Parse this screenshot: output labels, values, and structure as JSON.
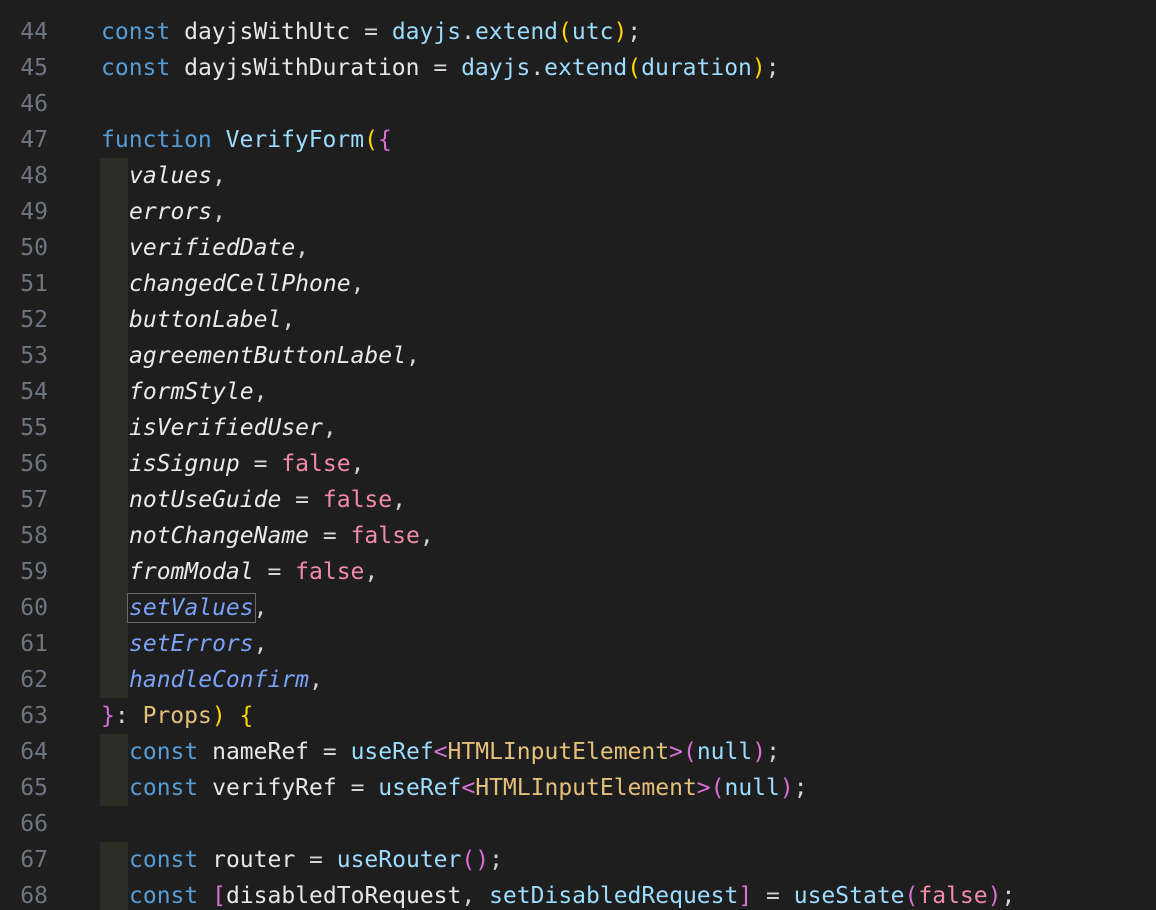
{
  "editor": {
    "language": "typescript",
    "theme_colors": {
      "background": "#1e1e1e",
      "line_number": "#6e7681",
      "keyword": "#569cd6",
      "function": "#dcdcaa",
      "boolean": "#f38ba8",
      "type": "#e5c07b"
    },
    "lines": [
      {
        "number": "44",
        "indent": 0,
        "tokens": [
          {
            "t": "const",
            "c": "kw"
          },
          {
            "t": " dayjsWithUtc ",
            "c": "plain"
          },
          {
            "t": "=",
            "c": "punc"
          },
          {
            "t": " dayjs",
            "c": "var"
          },
          {
            "t": ".",
            "c": "punc"
          },
          {
            "t": "extend",
            "c": "var"
          },
          {
            "t": "(",
            "c": "brace1"
          },
          {
            "t": "utc",
            "c": "var"
          },
          {
            "t": ")",
            "c": "brace1"
          },
          {
            "t": ";",
            "c": "punc"
          }
        ]
      },
      {
        "number": "45",
        "indent": 0,
        "tokens": [
          {
            "t": "const",
            "c": "kw"
          },
          {
            "t": " dayjsWithDuration ",
            "c": "plain"
          },
          {
            "t": "=",
            "c": "punc"
          },
          {
            "t": " dayjs",
            "c": "var"
          },
          {
            "t": ".",
            "c": "punc"
          },
          {
            "t": "extend",
            "c": "var"
          },
          {
            "t": "(",
            "c": "brace1"
          },
          {
            "t": "duration",
            "c": "var"
          },
          {
            "t": ")",
            "c": "brace1"
          },
          {
            "t": ";",
            "c": "punc"
          }
        ]
      },
      {
        "number": "46",
        "indent": 0,
        "tokens": []
      },
      {
        "number": "47",
        "indent": 0,
        "tokens": [
          {
            "t": "function",
            "c": "kw"
          },
          {
            "t": " VerifyForm",
            "c": "var"
          },
          {
            "t": "(",
            "c": "brace1"
          },
          {
            "t": "{",
            "c": "brace2"
          }
        ]
      },
      {
        "number": "48",
        "indent": 1,
        "tokens": [
          {
            "t": "values",
            "c": "param"
          },
          {
            "t": ",",
            "c": "punc"
          }
        ]
      },
      {
        "number": "49",
        "indent": 1,
        "tokens": [
          {
            "t": "errors",
            "c": "param"
          },
          {
            "t": ",",
            "c": "punc"
          }
        ]
      },
      {
        "number": "50",
        "indent": 1,
        "tokens": [
          {
            "t": "verifiedDate",
            "c": "param"
          },
          {
            "t": ",",
            "c": "punc"
          }
        ]
      },
      {
        "number": "51",
        "indent": 1,
        "tokens": [
          {
            "t": "changedCellPhone",
            "c": "param"
          },
          {
            "t": ",",
            "c": "punc"
          }
        ]
      },
      {
        "number": "52",
        "indent": 1,
        "tokens": [
          {
            "t": "buttonLabel",
            "c": "param"
          },
          {
            "t": ",",
            "c": "punc"
          }
        ]
      },
      {
        "number": "53",
        "indent": 1,
        "tokens": [
          {
            "t": "agreementButtonLabel",
            "c": "param"
          },
          {
            "t": ",",
            "c": "punc"
          }
        ]
      },
      {
        "number": "54",
        "indent": 1,
        "tokens": [
          {
            "t": "formStyle",
            "c": "param"
          },
          {
            "t": ",",
            "c": "punc"
          }
        ]
      },
      {
        "number": "55",
        "indent": 1,
        "tokens": [
          {
            "t": "isVerifiedUser",
            "c": "param"
          },
          {
            "t": ",",
            "c": "punc"
          }
        ]
      },
      {
        "number": "56",
        "indent": 1,
        "tokens": [
          {
            "t": "isSignup",
            "c": "param"
          },
          {
            "t": " = ",
            "c": "punc"
          },
          {
            "t": "false",
            "c": "bool"
          },
          {
            "t": ",",
            "c": "punc"
          }
        ]
      },
      {
        "number": "57",
        "indent": 1,
        "tokens": [
          {
            "t": "notUseGuide",
            "c": "param"
          },
          {
            "t": " = ",
            "c": "punc"
          },
          {
            "t": "false",
            "c": "bool"
          },
          {
            "t": ",",
            "c": "punc"
          }
        ]
      },
      {
        "number": "58",
        "indent": 1,
        "tokens": [
          {
            "t": "notChangeName",
            "c": "param"
          },
          {
            "t": " = ",
            "c": "punc"
          },
          {
            "t": "false",
            "c": "bool"
          },
          {
            "t": ",",
            "c": "punc"
          }
        ]
      },
      {
        "number": "59",
        "indent": 1,
        "tokens": [
          {
            "t": "fromModal",
            "c": "param"
          },
          {
            "t": " = ",
            "c": "punc"
          },
          {
            "t": "false",
            "c": "bool"
          },
          {
            "t": ",",
            "c": "punc"
          }
        ]
      },
      {
        "number": "60",
        "indent": 1,
        "tokens": [
          {
            "t": "setValues",
            "c": "param-fn",
            "selected": true
          },
          {
            "t": ",",
            "c": "punc"
          }
        ]
      },
      {
        "number": "61",
        "indent": 1,
        "tokens": [
          {
            "t": "setErrors",
            "c": "param-fn"
          },
          {
            "t": ",",
            "c": "punc"
          }
        ]
      },
      {
        "number": "62",
        "indent": 1,
        "tokens": [
          {
            "t": "handleConfirm",
            "c": "param-fn"
          },
          {
            "t": ",",
            "c": "punc"
          }
        ]
      },
      {
        "number": "63",
        "indent": 0,
        "tokens": [
          {
            "t": "}",
            "c": "brace2"
          },
          {
            "t": ": ",
            "c": "punc"
          },
          {
            "t": "Props",
            "c": "type"
          },
          {
            "t": ")",
            "c": "brace1"
          },
          {
            "t": " ",
            "c": "punc"
          },
          {
            "t": "{",
            "c": "brace1"
          }
        ]
      },
      {
        "number": "64",
        "indent": 1,
        "tokens": [
          {
            "t": "const",
            "c": "kw"
          },
          {
            "t": " nameRef ",
            "c": "plain"
          },
          {
            "t": "=",
            "c": "punc"
          },
          {
            "t": " useRef",
            "c": "var"
          },
          {
            "t": "<",
            "c": "brace2"
          },
          {
            "t": "HTMLInputElement",
            "c": "type"
          },
          {
            "t": ">",
            "c": "brace2"
          },
          {
            "t": "(",
            "c": "brace2"
          },
          {
            "t": "null",
            "c": "null"
          },
          {
            "t": ")",
            "c": "brace2"
          },
          {
            "t": ";",
            "c": "punc"
          }
        ]
      },
      {
        "number": "65",
        "indent": 1,
        "tokens": [
          {
            "t": "const",
            "c": "kw"
          },
          {
            "t": " verifyRef ",
            "c": "plain"
          },
          {
            "t": "=",
            "c": "punc"
          },
          {
            "t": " useRef",
            "c": "var"
          },
          {
            "t": "<",
            "c": "brace2"
          },
          {
            "t": "HTMLInputElement",
            "c": "type"
          },
          {
            "t": ">",
            "c": "brace2"
          },
          {
            "t": "(",
            "c": "brace2"
          },
          {
            "t": "null",
            "c": "null"
          },
          {
            "t": ")",
            "c": "brace2"
          },
          {
            "t": ";",
            "c": "punc"
          }
        ]
      },
      {
        "number": "66",
        "indent": 0,
        "tokens": []
      },
      {
        "number": "67",
        "indent": 1,
        "tokens": [
          {
            "t": "const",
            "c": "kw"
          },
          {
            "t": " router ",
            "c": "plain"
          },
          {
            "t": "=",
            "c": "punc"
          },
          {
            "t": " useRouter",
            "c": "var"
          },
          {
            "t": "(",
            "c": "brace2"
          },
          {
            "t": ")",
            "c": "brace2"
          },
          {
            "t": ";",
            "c": "punc"
          }
        ]
      },
      {
        "number": "68",
        "indent": 1,
        "tokens": [
          {
            "t": "const",
            "c": "kw"
          },
          {
            "t": " ",
            "c": "plain"
          },
          {
            "t": "[",
            "c": "brace2"
          },
          {
            "t": "disabledToRequest",
            "c": "plain"
          },
          {
            "t": ", ",
            "c": "punc"
          },
          {
            "t": "setDisabledRequest",
            "c": "var"
          },
          {
            "t": "]",
            "c": "brace2"
          },
          {
            "t": " = ",
            "c": "punc"
          },
          {
            "t": "useState",
            "c": "var"
          },
          {
            "t": "(",
            "c": "brace2"
          },
          {
            "t": "false",
            "c": "bool"
          },
          {
            "t": ")",
            "c": "brace2"
          },
          {
            "t": ";",
            "c": "punc"
          }
        ]
      }
    ]
  }
}
